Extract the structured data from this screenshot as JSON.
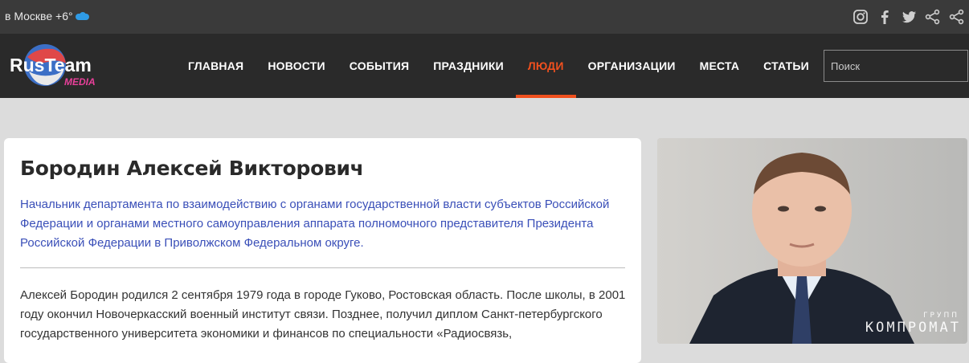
{
  "topbar": {
    "weather_text": "в Москве +6°",
    "weather_icon": "cloud-icon",
    "social_icons": [
      "instagram-icon",
      "facebook-icon",
      "twitter-icon",
      "share-icon",
      "share-icon"
    ]
  },
  "logo": {
    "title": "RusTeam",
    "subtitle": "MEDIA"
  },
  "nav": {
    "items": [
      {
        "label": "ГЛАВНАЯ",
        "active": false
      },
      {
        "label": "НОВОСТИ",
        "active": false
      },
      {
        "label": "СОБЫТИЯ",
        "active": false
      },
      {
        "label": "ПРАЗДНИКИ",
        "active": false
      },
      {
        "label": "ЛЮДИ",
        "active": true
      },
      {
        "label": "ОРГАНИЗАЦИИ",
        "active": false
      },
      {
        "label": "МЕСТА",
        "active": false
      },
      {
        "label": "СТАТЬИ",
        "active": false
      }
    ]
  },
  "search": {
    "placeholder": "Поиск",
    "value": ""
  },
  "person": {
    "name": "Бородин Алексей Викторович",
    "position": "Начальник департамента по взаимодействию с органами государственной власти субъектов Российской Федерации и органами местного самоуправления аппарата полномочного представителя Президента Российской Федерации в Приволжском Федеральном округе.",
    "bio": "Алексей Бородин родился 2 сентября 1979 года в городе Гуково, Ростовская область. После школы, в 2001 году окончил Новочеркасский военный институт связи. Позднее, получил диплом Санкт-петербургского государственного университета экономики и финансов по специальности «Радиосвязь,"
  },
  "photo": {
    "watermark_top": "ГРУПП",
    "watermark_main": "КОМПРОМАТ"
  },
  "colors": {
    "accent": "#f0501e",
    "link": "#3a4fb8",
    "navbar": "#2a2a2a",
    "topbar": "#3a3a3a"
  }
}
